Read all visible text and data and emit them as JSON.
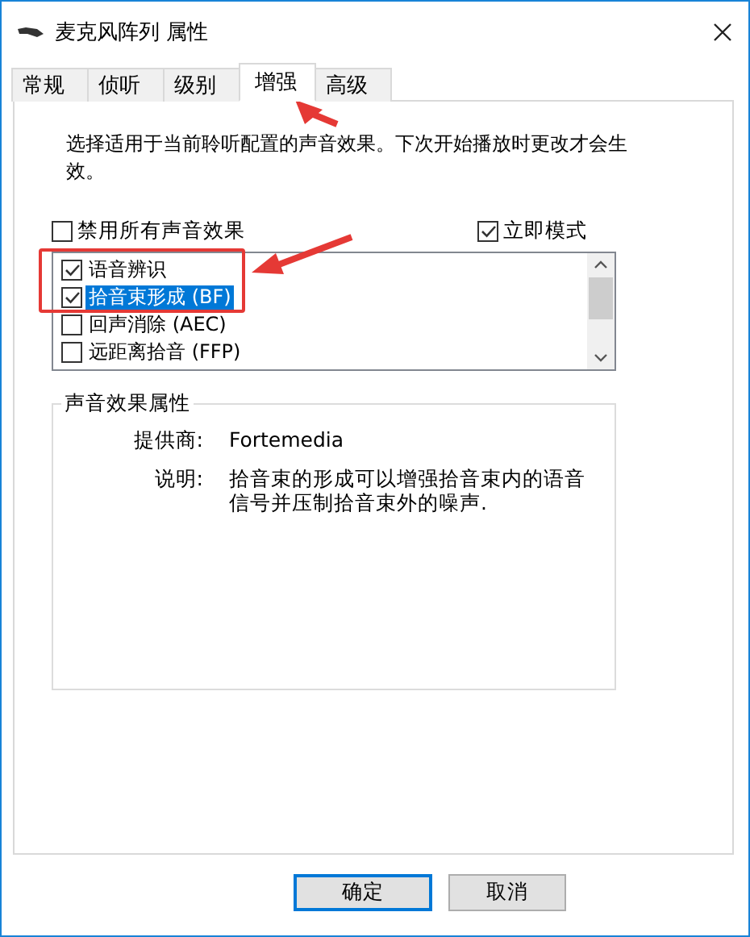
{
  "window": {
    "title": "麦克风阵列 属性"
  },
  "tabs": [
    {
      "label": "常规",
      "selected": false
    },
    {
      "label": "侦听",
      "selected": false
    },
    {
      "label": "级别",
      "selected": false
    },
    {
      "label": "增强",
      "selected": true
    },
    {
      "label": "高级",
      "selected": false
    }
  ],
  "description": "选择适用于当前聆听配置的声音效果。下次开始播放时更改才会生效。",
  "options": [
    {
      "label": "禁用所有声音效果",
      "checked": false
    },
    {
      "label": "立即模式",
      "checked": true
    }
  ],
  "effects": [
    {
      "label": "语音辨识",
      "checked": true,
      "selected": false
    },
    {
      "label": "拾音束形成 (BF)",
      "checked": true,
      "selected": true
    },
    {
      "label": "回声消除 (AEC)",
      "checked": false,
      "selected": false
    },
    {
      "label": "远距离拾音 (FFP)",
      "checked": false,
      "selected": false
    }
  ],
  "properties": {
    "title": "声音效果属性",
    "rows": [
      {
        "label": "提供商:",
        "value": "Fortemedia"
      },
      {
        "label": "说明:",
        "value": "拾音束的形成可以增强拾音束内的语音信号并压制拾音束外的噪声."
      }
    ]
  },
  "buttons": [
    {
      "label": "确定",
      "default": true
    },
    {
      "label": "取消",
      "default": false
    }
  ]
}
